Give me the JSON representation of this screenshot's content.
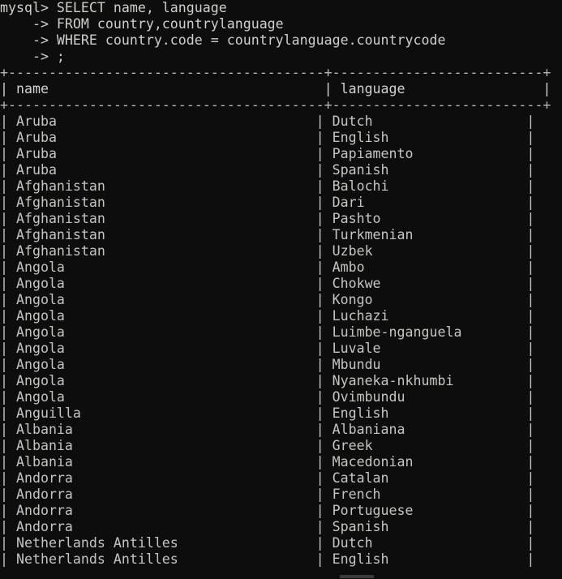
{
  "terminal": {
    "title": "mysql command line client",
    "prompt": "mysql> ",
    "continuation_prompt": "    -> ",
    "colors": {
      "background": "#0d0d0d",
      "foreground": "#c9c9c4",
      "rule": "#b8b8b3"
    },
    "query_lines": [
      "mysql> SELECT name, language",
      "    -> FROM country,countrylanguage",
      "    -> WHERE country.code = countrylanguage.countrycode",
      "    -> ;"
    ],
    "statement": {
      "select": "SELECT name, language",
      "from": "FROM country,countrylanguage",
      "where": "WHERE country.code = countrylanguage.countrycode",
      "terminator": ";"
    }
  },
  "result_table": {
    "rule_top": "+---------------------------------------+--------------------------+",
    "rule_mid": "+---------------------------------------+--------------------------+",
    "columns": [
      {
        "name": "name",
        "width": 39
      },
      {
        "name": "language",
        "width": 26
      }
    ],
    "header_line": "| name                                  | language                 |",
    "rows": [
      {
        "name": "Aruba",
        "language": "Dutch"
      },
      {
        "name": "Aruba",
        "language": "English"
      },
      {
        "name": "Aruba",
        "language": "Papiamento"
      },
      {
        "name": "Aruba",
        "language": "Spanish"
      },
      {
        "name": "Afghanistan",
        "language": "Balochi"
      },
      {
        "name": "Afghanistan",
        "language": "Dari"
      },
      {
        "name": "Afghanistan",
        "language": "Pashto"
      },
      {
        "name": "Afghanistan",
        "language": "Turkmenian"
      },
      {
        "name": "Afghanistan",
        "language": "Uzbek"
      },
      {
        "name": "Angola",
        "language": "Ambo"
      },
      {
        "name": "Angola",
        "language": "Chokwe"
      },
      {
        "name": "Angola",
        "language": "Kongo"
      },
      {
        "name": "Angola",
        "language": "Luchazi"
      },
      {
        "name": "Angola",
        "language": "Luimbe-nganguela"
      },
      {
        "name": "Angola",
        "language": "Luvale"
      },
      {
        "name": "Angola",
        "language": "Mbundu"
      },
      {
        "name": "Angola",
        "language": "Nyaneka-nkhumbi"
      },
      {
        "name": "Angola",
        "language": "Ovimbundu"
      },
      {
        "name": "Anguilla",
        "language": "English"
      },
      {
        "name": "Albania",
        "language": "Albaniana"
      },
      {
        "name": "Albania",
        "language": "Greek"
      },
      {
        "name": "Albania",
        "language": "Macedonian"
      },
      {
        "name": "Andorra",
        "language": "Catalan"
      },
      {
        "name": "Andorra",
        "language": "French"
      },
      {
        "name": "Andorra",
        "language": "Portuguese"
      },
      {
        "name": "Andorra",
        "language": "Spanish"
      },
      {
        "name": "Netherlands Antilles",
        "language": "Dutch"
      },
      {
        "name": "Netherlands Antilles",
        "language": "English"
      }
    ]
  }
}
